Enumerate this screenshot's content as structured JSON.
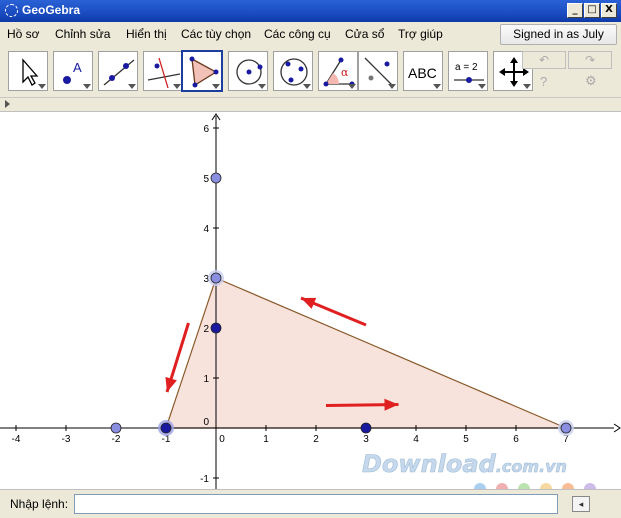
{
  "window": {
    "title": "GeoGebra",
    "minimize": "_",
    "maximize": "□",
    "close": "X"
  },
  "menu": [
    "Hồ sơ",
    "Chỉnh sửa",
    "Hiển thị",
    "Các tùy chọn",
    "Các công cụ",
    "Cửa sổ",
    "Trợ giúp"
  ],
  "account": {
    "signed_in_label": "Signed in as July"
  },
  "toolbar": {
    "tools": [
      {
        "name": "move-tool-icon"
      },
      {
        "name": "point-tool-icon",
        "label": "A"
      },
      {
        "name": "line-tool-icon"
      },
      {
        "name": "perpendicular-line-tool-icon"
      },
      {
        "name": "polygon-tool-icon",
        "selected": true
      },
      {
        "name": "circle-tool-icon"
      },
      {
        "name": "conic-tool-icon"
      },
      {
        "name": "angle-tool-icon",
        "label": "α"
      },
      {
        "name": "reflect-tool-icon"
      },
      {
        "name": "text-tool-icon",
        "label": "ABC"
      },
      {
        "name": "slider-tool-icon",
        "label": "a = 2"
      },
      {
        "name": "move-view-tool-icon"
      }
    ],
    "undo_icon": "↶",
    "redo_icon": "↷",
    "help_icon": "?",
    "settings_icon": "⚙"
  },
  "graphics": {
    "x_ticks": [
      "-4",
      "-3",
      "-2",
      "-1",
      "0",
      "1",
      "2",
      "3",
      "4",
      "5",
      "6",
      "7"
    ],
    "y_ticks": [
      "-1",
      "1",
      "2",
      "3",
      "4",
      "5",
      "6"
    ],
    "y_zero_label": "0",
    "triangle": {
      "vertices": [
        [
          -1,
          0
        ],
        [
          0,
          3
        ],
        [
          7,
          0
        ]
      ],
      "fill": "#f8e2dc",
      "stroke": "#8b5a2b"
    },
    "points": [
      {
        "x": 0,
        "y": 5,
        "style": "light"
      },
      {
        "x": 0,
        "y": 3,
        "style": "light-large"
      },
      {
        "x": 0,
        "y": 2,
        "style": "dark"
      },
      {
        "x": -2,
        "y": 0,
        "style": "light"
      },
      {
        "x": -1,
        "y": 0,
        "style": "dark-large"
      },
      {
        "x": 3,
        "y": 0,
        "style": "dark"
      },
      {
        "x": 7,
        "y": 0,
        "style": "light-large"
      }
    ],
    "annotation_color": "#e02020",
    "point_light_color": "#8a8ee0",
    "point_dark_color": "#1a1aa0",
    "watermark": {
      "text": "Download",
      "suffix": ".com.vn",
      "dot_colors": [
        "#6fb1e8",
        "#e87b7b",
        "#8cd07a",
        "#f0c060",
        "#f09050",
        "#b090d8"
      ]
    }
  },
  "input_bar": {
    "label": "Nhập lệnh:",
    "value": "",
    "button_icon": "◂"
  }
}
